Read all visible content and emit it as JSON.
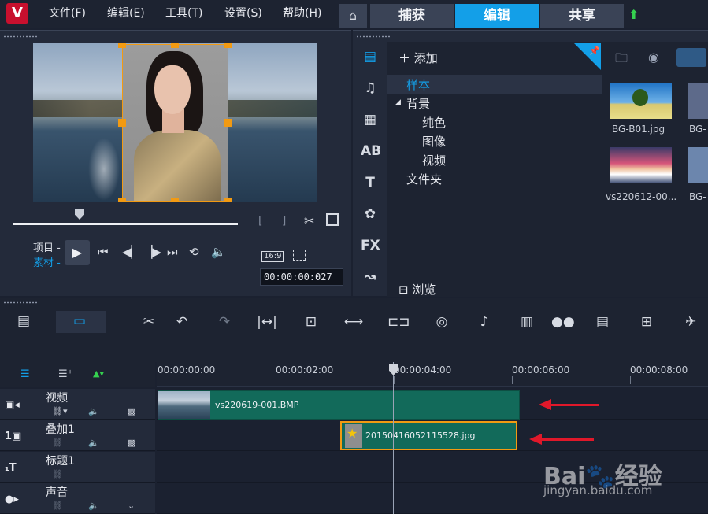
{
  "menu": {
    "logo": "V",
    "items": [
      "文件(F)",
      "编辑(E)",
      "工具(T)",
      "设置(S)",
      "帮助(H)"
    ]
  },
  "modes": {
    "capture": "捕获",
    "edit": "编辑",
    "share": "共享"
  },
  "player": {
    "label_project": "项目 -",
    "label_clip": "素材 -",
    "aspect": "16:9",
    "timecode": "00:00:00:027",
    "mark_in_out": "[ ]"
  },
  "library": {
    "add_label": "添加",
    "tree": {
      "sample": "样本",
      "background": "背景",
      "solid": "纯色",
      "image": "图像",
      "video": "视频",
      "folder": "文件夹"
    },
    "browse_label": "浏览",
    "side_icons": [
      "media-icon",
      "audio-icon",
      "instant-project-icon",
      "transition-icon",
      "title-icon",
      "graphic-icon",
      "filter-icon",
      "path-icon"
    ],
    "thumbs": [
      {
        "label": "BG-B01.jpg"
      },
      {
        "label": "BG-"
      },
      {
        "label": "vs220612-00..."
      },
      {
        "label": "BG-"
      }
    ]
  },
  "timeline": {
    "ruler": [
      "00:00:00:00",
      "00:00:02:00",
      "00:00:04:00",
      "00:00:06:00",
      "00:00:08:00"
    ],
    "tracks": [
      {
        "name": "视频",
        "icon": "▣◂"
      },
      {
        "name": "叠加1",
        "icon": "1▣"
      },
      {
        "name": "标题1",
        "icon": "₁T"
      },
      {
        "name": "声音",
        "icon": "●▸"
      }
    ],
    "clips": {
      "video": "vs220619-001.BMP",
      "overlay": "20150416052115528.jpg"
    }
  },
  "watermark": {
    "logo": "Bai🐾经验",
    "url": "jingyan.baidu.com"
  },
  "colors": {
    "accent": "#139fe8",
    "clip": "#126a5a",
    "selection": "#f29a12",
    "arrow": "#e0182a"
  }
}
